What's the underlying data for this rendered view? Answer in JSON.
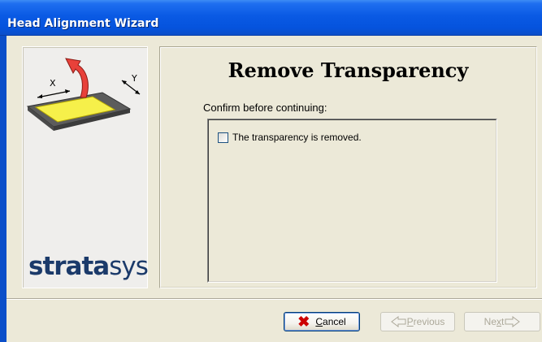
{
  "window": {
    "title": "Head Alignment Wizard"
  },
  "side_panel": {
    "illustration": {
      "axis_x": "X",
      "axis_y": "Y",
      "colors": {
        "platform": "#5c5c5c",
        "transparency": "#f6f04a",
        "arrow": "#e8413a"
      }
    },
    "logo": {
      "bold": "strata",
      "light": "sys",
      "color": "#1b3a6a"
    }
  },
  "page": {
    "title": "Remove Transparency",
    "confirm_label": "Confirm before continuing:",
    "checkbox": {
      "label": "The transparency is removed.",
      "checked": false
    }
  },
  "buttons": {
    "cancel": {
      "label_ul": "C",
      "label_rest": "ancel",
      "icon": "red-x-icon",
      "enabled": true
    },
    "previous": {
      "label_ul": "P",
      "label_rest": "revious",
      "icon": "arrow-left-icon",
      "enabled": false
    },
    "next": {
      "label_pre": "Ne",
      "label_ul": "x",
      "label_rest": "t",
      "icon": "arrow-right-icon",
      "enabled": false
    }
  },
  "colors": {
    "titlebar": "#0553dd",
    "dialog_bg": "#ece9d8"
  }
}
